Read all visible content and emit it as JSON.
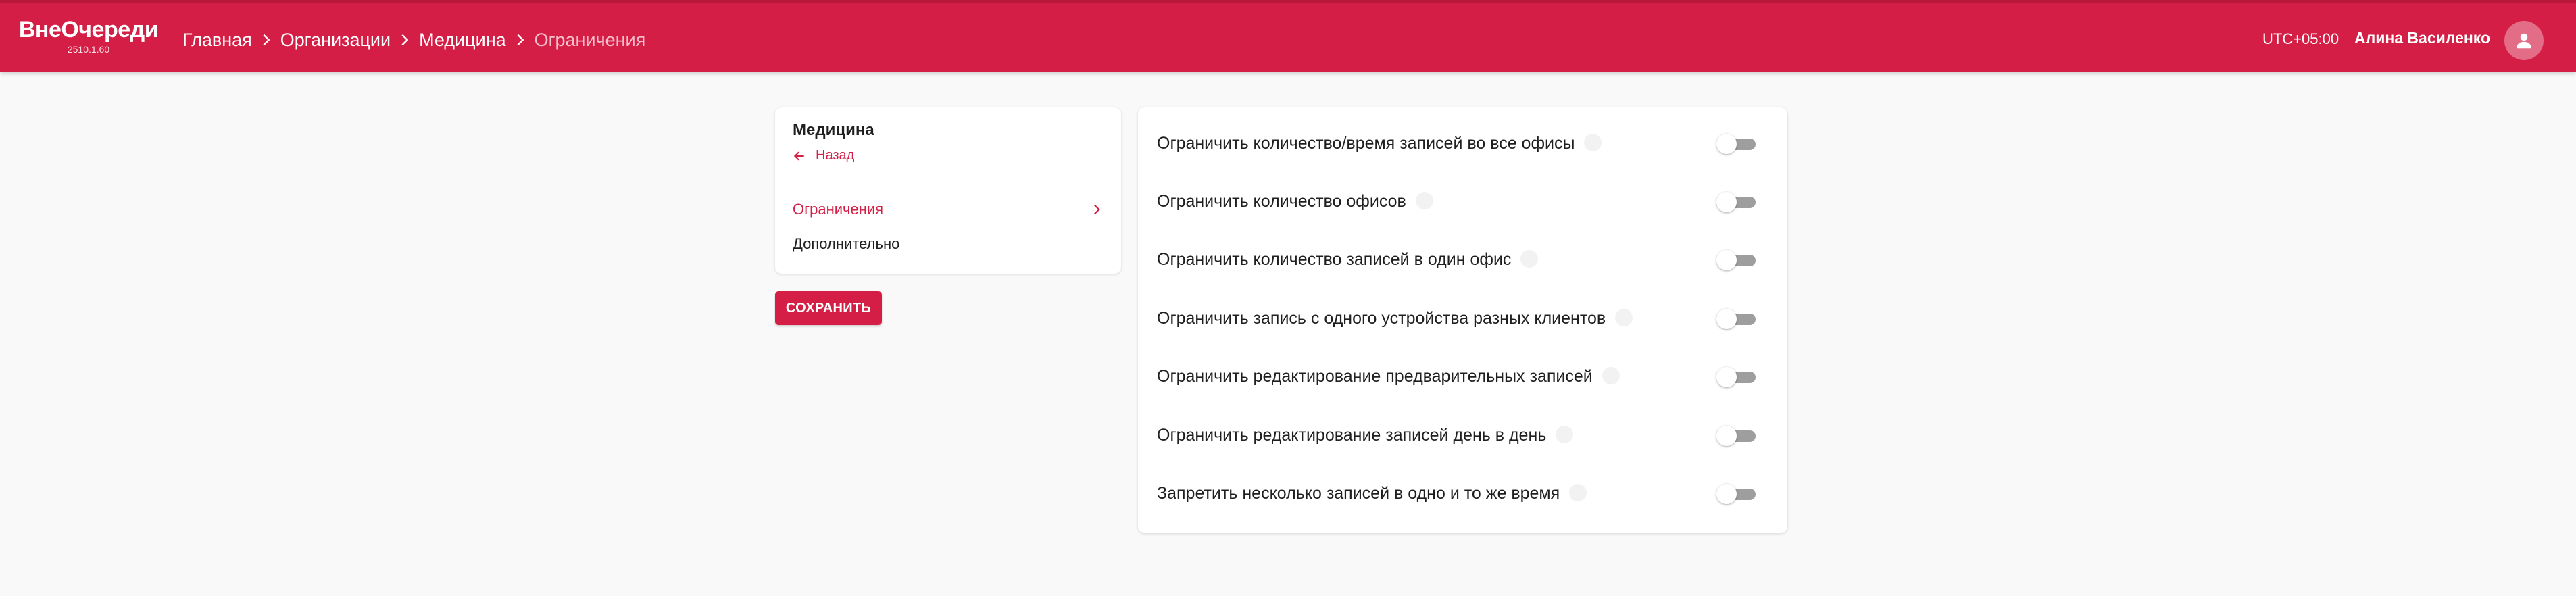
{
  "header": {
    "logo_name": "ВнеОчереди",
    "version": "2510.1.60",
    "breadcrumb": [
      "Главная",
      "Организации",
      "Медицина",
      "Ограничения"
    ],
    "timezone": "UTC+05:00",
    "user_name": "Алина Василенко",
    "accent_color": "#d41e45"
  },
  "sidebar": {
    "title": "Медицина",
    "back_label": "Назад",
    "items": [
      {
        "label": "Ограничения",
        "active": true
      },
      {
        "label": "Дополнительно",
        "active": false
      }
    ]
  },
  "actions": {
    "save_label": "СОХРАНИТЬ"
  },
  "settings": [
    {
      "label": "Ограничить количество/время записей во все офисы",
      "enabled": false
    },
    {
      "label": "Ограничить количество офисов",
      "enabled": false
    },
    {
      "label": "Ограничить количество записей в один офис",
      "enabled": false
    },
    {
      "label": "Ограничить запись с одного устройства разных клиентов",
      "enabled": false
    },
    {
      "label": "Ограничить редактирование предварительных записей",
      "enabled": false
    },
    {
      "label": "Ограничить редактирование записей день в день",
      "enabled": false
    },
    {
      "label": "Запретить несколько записей в одно и то же время",
      "enabled": false
    }
  ]
}
